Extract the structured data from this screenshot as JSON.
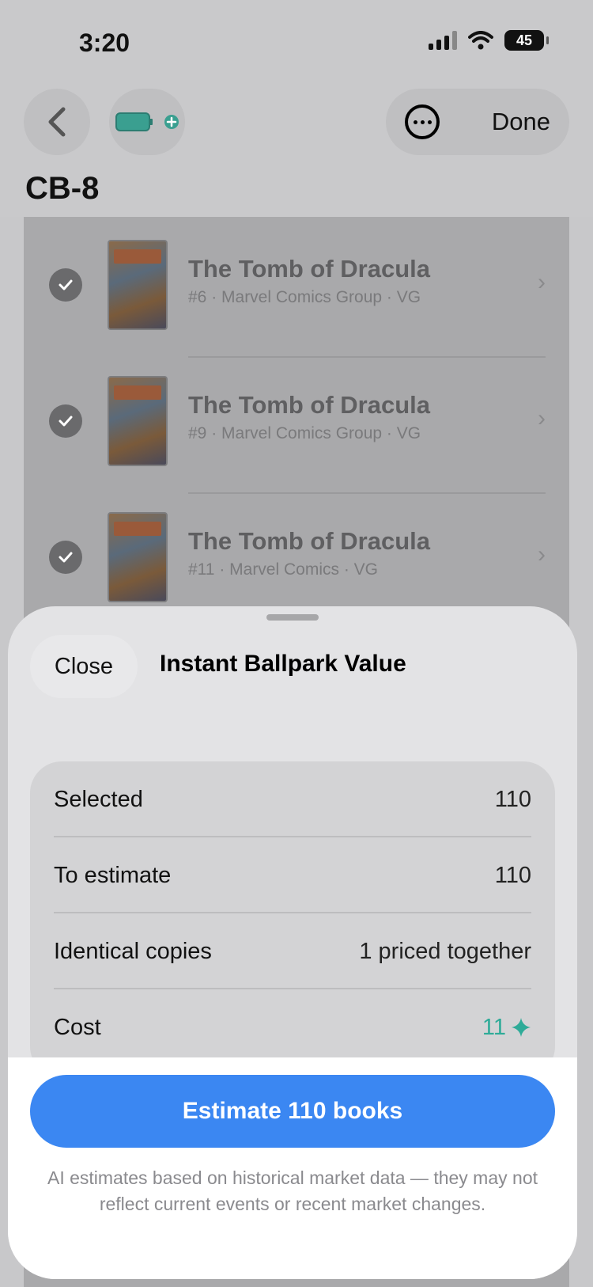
{
  "status_bar": {
    "time": "3:20",
    "battery": "45"
  },
  "header": {
    "title": "CB-8",
    "done_label": "Done"
  },
  "list": {
    "items": [
      {
        "title": "The Tomb of Dracula",
        "subtitle": "#6 · Marvel Comics Group · VG"
      },
      {
        "title": "The Tomb of Dracula",
        "subtitle": "#9 · Marvel Comics Group · VG"
      },
      {
        "title": "The Tomb of Dracula",
        "subtitle": "#11 · Marvel Comics · VG"
      }
    ]
  },
  "sheet": {
    "close_label": "Close",
    "title": "Instant Ballpark Value",
    "rows": [
      {
        "label": "Selected",
        "value": "110"
      },
      {
        "label": "To estimate",
        "value": "110"
      },
      {
        "label": "Identical copies",
        "value": "1 priced together"
      },
      {
        "label": "Cost",
        "value": "11"
      }
    ],
    "estimate_button": "Estimate 110 books",
    "disclaimer": "AI estimates based on historical market data — they may not reflect current events or recent market changes."
  },
  "colors": {
    "accent": "#3b87f2",
    "cost": "#2eab98"
  },
  "icons": [
    "back-chevron-icon",
    "battery-tag-icon",
    "more-icon",
    "check-icon",
    "chevron-right-icon",
    "sparkle-icon"
  ]
}
